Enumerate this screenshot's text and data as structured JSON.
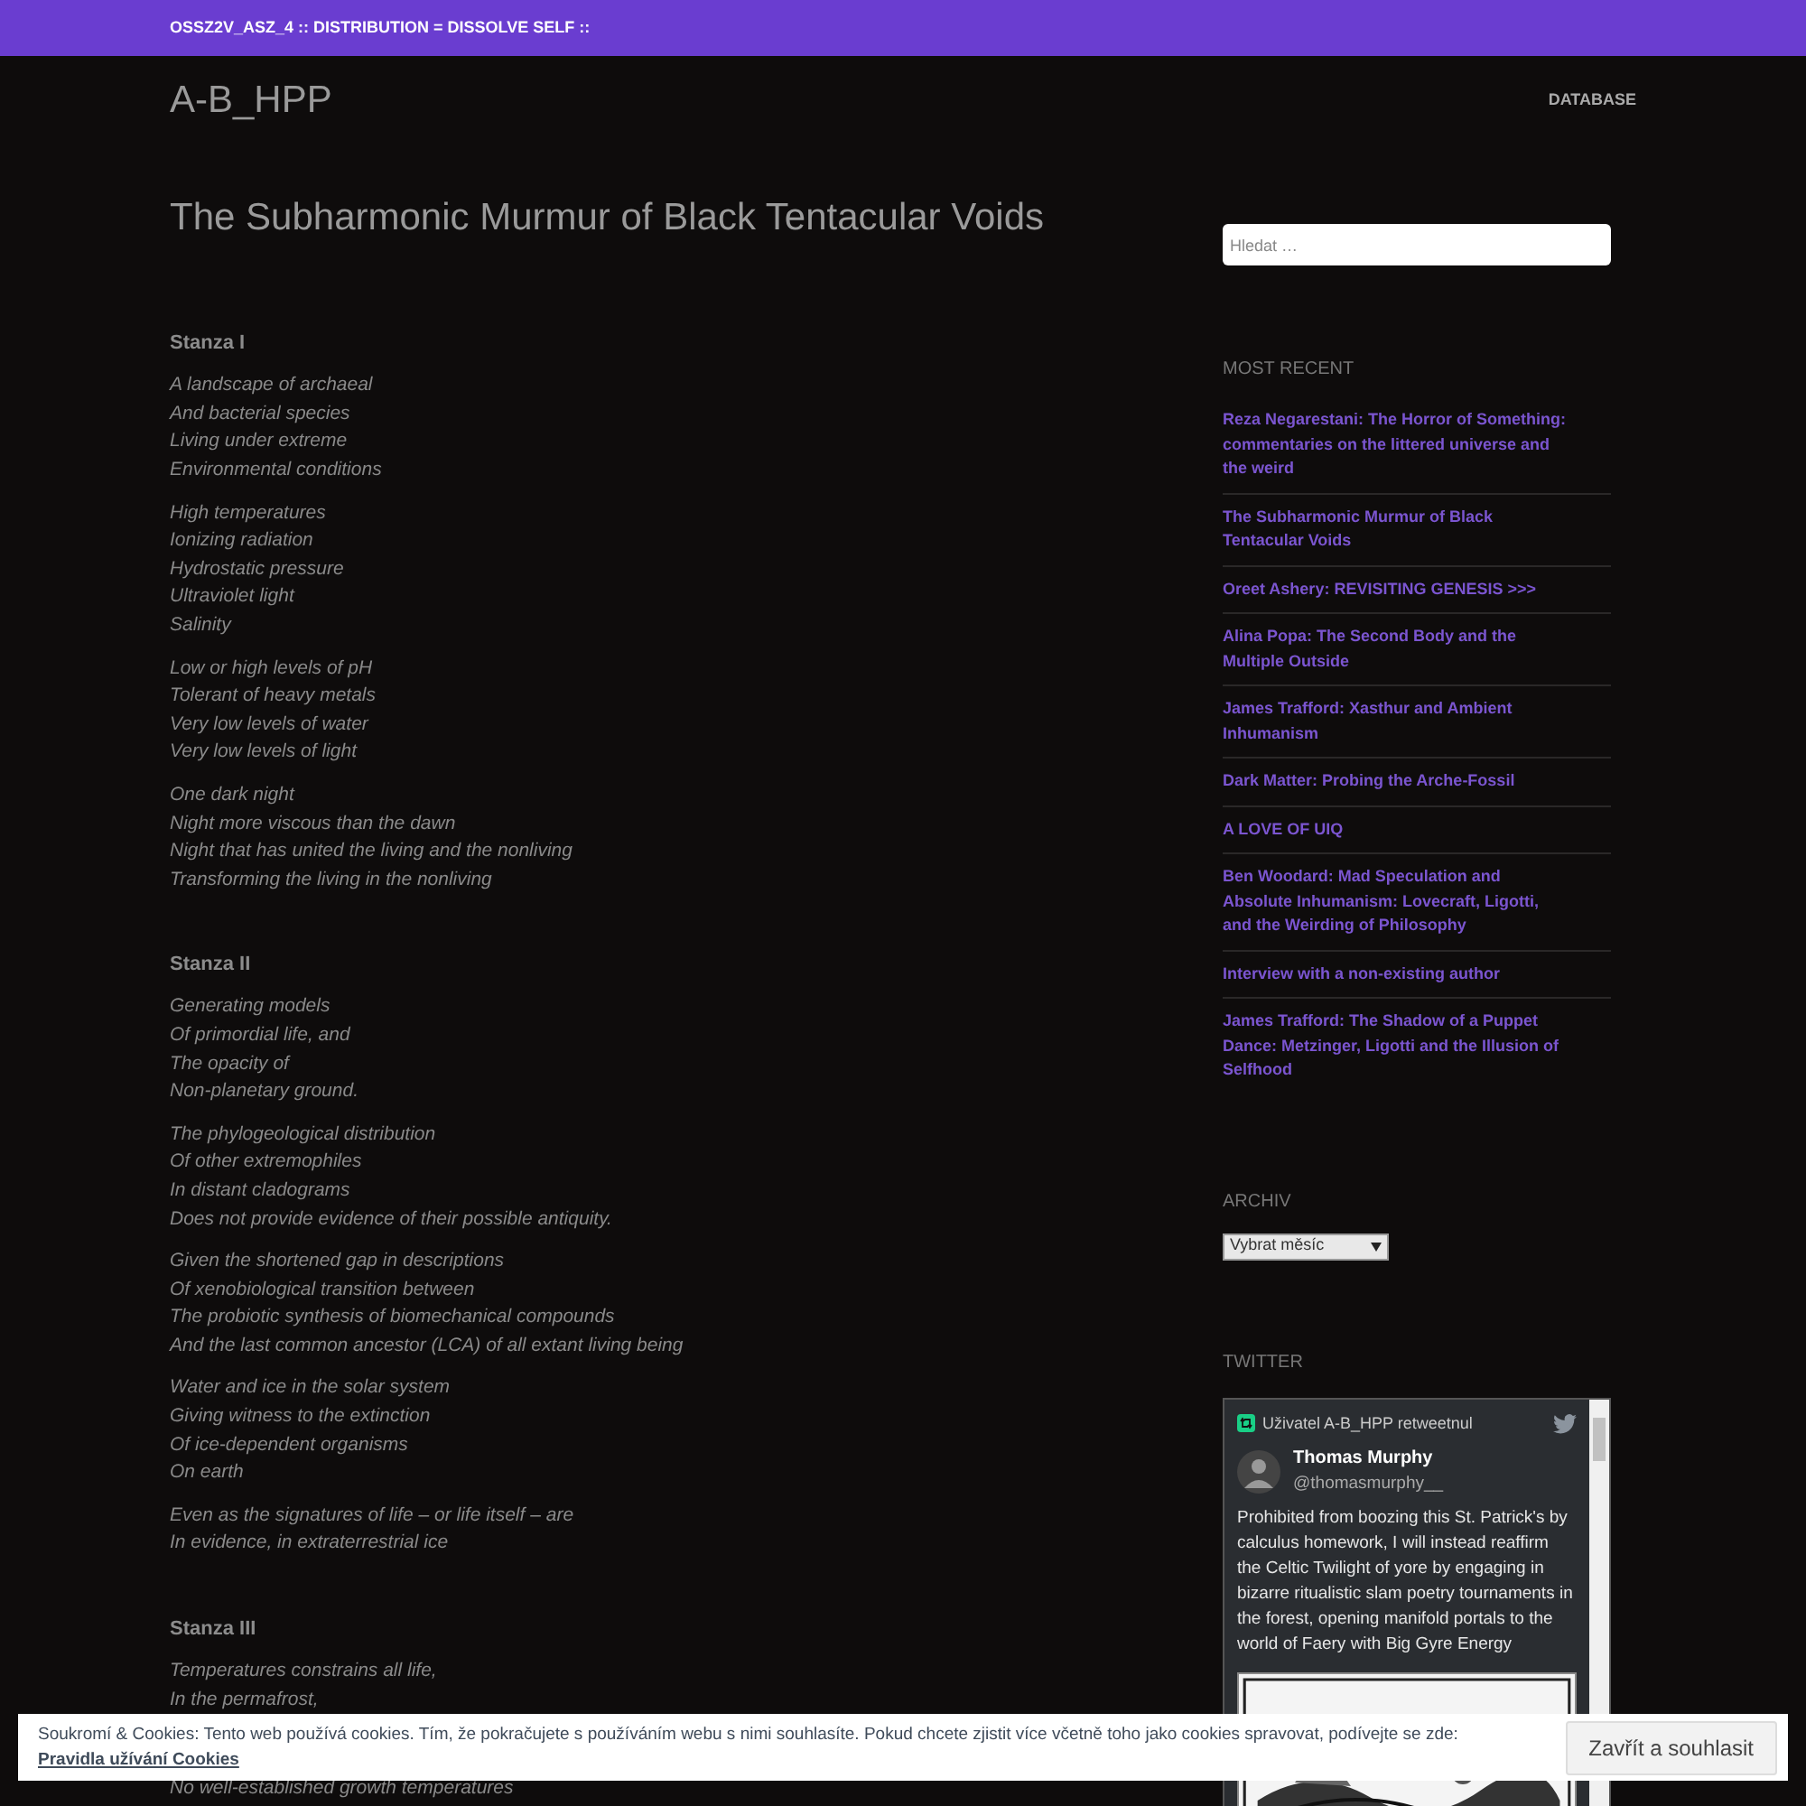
{
  "top_bar": {
    "text": "OSSZ2V_ASZ_4 :: DISTRIBUTION = DISSOLVE SELF ::"
  },
  "site_title": "A-B_HPP",
  "nav": [
    {
      "label": "DATABASE"
    }
  ],
  "post": {
    "title": "The Subharmonic Murmur of Black Tentacular Voids",
    "stanzas": [
      {
        "heading": "Stanza I",
        "paragraphs": [
          [
            "A landscape of archaeal",
            "And bacterial species",
            "Living under extreme",
            "Environmental conditions"
          ],
          [
            "High temperatures",
            "Ionizing radiation",
            "Hydrostatic pressure",
            "Ultraviolet light",
            "Salinity"
          ],
          [
            "Low or high levels of pH",
            "Tolerant of heavy metals",
            "Very low levels of water",
            "Very low levels of light"
          ],
          [
            "One dark night",
            "Night more viscous than the dawn",
            "Night that has united the living and the nonliving",
            "Transforming the living in the nonliving"
          ]
        ]
      },
      {
        "heading": "Stanza II",
        "paragraphs": [
          [
            "Generating models",
            "Of primordial life, and",
            "The opacity of",
            "Non-planetary ground."
          ],
          [
            "The phylogeological distribution",
            "Of other extremophiles",
            "In distant cladograms",
            "Does not provide evidence of their possible antiquity."
          ],
          [
            "Given the shortened gap in descriptions",
            "Of xenobiological transition between",
            "The probiotic synthesis of biomechanical compounds",
            "And the last common ancestor (LCA) of all extant living being"
          ],
          [
            "Water and ice in the solar system",
            "Giving witness to the extinction",
            "Of ice-dependent organisms",
            "On earth"
          ],
          [
            "Even as the signatures of life – or life itself – are",
            "In evidence, in extraterrestrial ice"
          ]
        ]
      },
      {
        "heading": "Stanza III",
        "paragraphs": [
          [
            "Temperatures constrains all life,",
            "In the permafrost,"
          ],
          [
            "No well-established growth temperatures"
          ]
        ]
      }
    ]
  },
  "sidebar": {
    "search": {
      "placeholder": "Hledat …"
    },
    "most_recent": {
      "heading": "MOST RECENT",
      "items": [
        "Reza Negarestani: The Horror of Something: commentaries on the littered universe and the weird",
        "The Subharmonic Murmur of Black Tentacular Voids",
        "Oreet Ashery: REVISITING GENESIS >>>",
        "Alina Popa: The Second Body and the Multiple Outside",
        "James Trafford: Xasthur and Ambient Inhumanism",
        "Dark Matter: Probing the Arche-Fossil",
        "A LOVE OF UIQ",
        "Ben Woodard: Mad Speculation and Absolute Inhumanism: Lovecraft, Ligotti, and the Weirding of Philosophy",
        "Interview with a non-existing author",
        "James Trafford: The Shadow of a Puppet Dance: Metzinger, Ligotti and the Illusion of Selfhood"
      ]
    },
    "archive": {
      "heading": "ARCHIV",
      "select": "Vybrat měsíc"
    },
    "twitter": {
      "heading": "TWITTER",
      "retweet_label": "Uživatel A-B_HPP retweetnul",
      "author_name": "Thomas Murphy",
      "handle": "@thomasmurphy__",
      "text": "Prohibited from boozing this St. Patrick's by calculus homework, I will instead reaffirm the Celtic Twilight of yore by engaging in bizarre ritualistic slam poetry tournaments in the forest, opening manifold portals to the world of Faery with Big Gyre Energy"
    }
  },
  "cookie_bar": {
    "text": "Soukromí & Cookies: Tento web používá cookies. Tím, že pokračujete s používáním webu s nimi souhlasíte. Pokud chcete zjistit více včetně toho jako cookies spravovat, podívejte se zde: ",
    "link": "Pravidla užívání Cookies",
    "button": "Zavřít a souhlasit"
  }
}
